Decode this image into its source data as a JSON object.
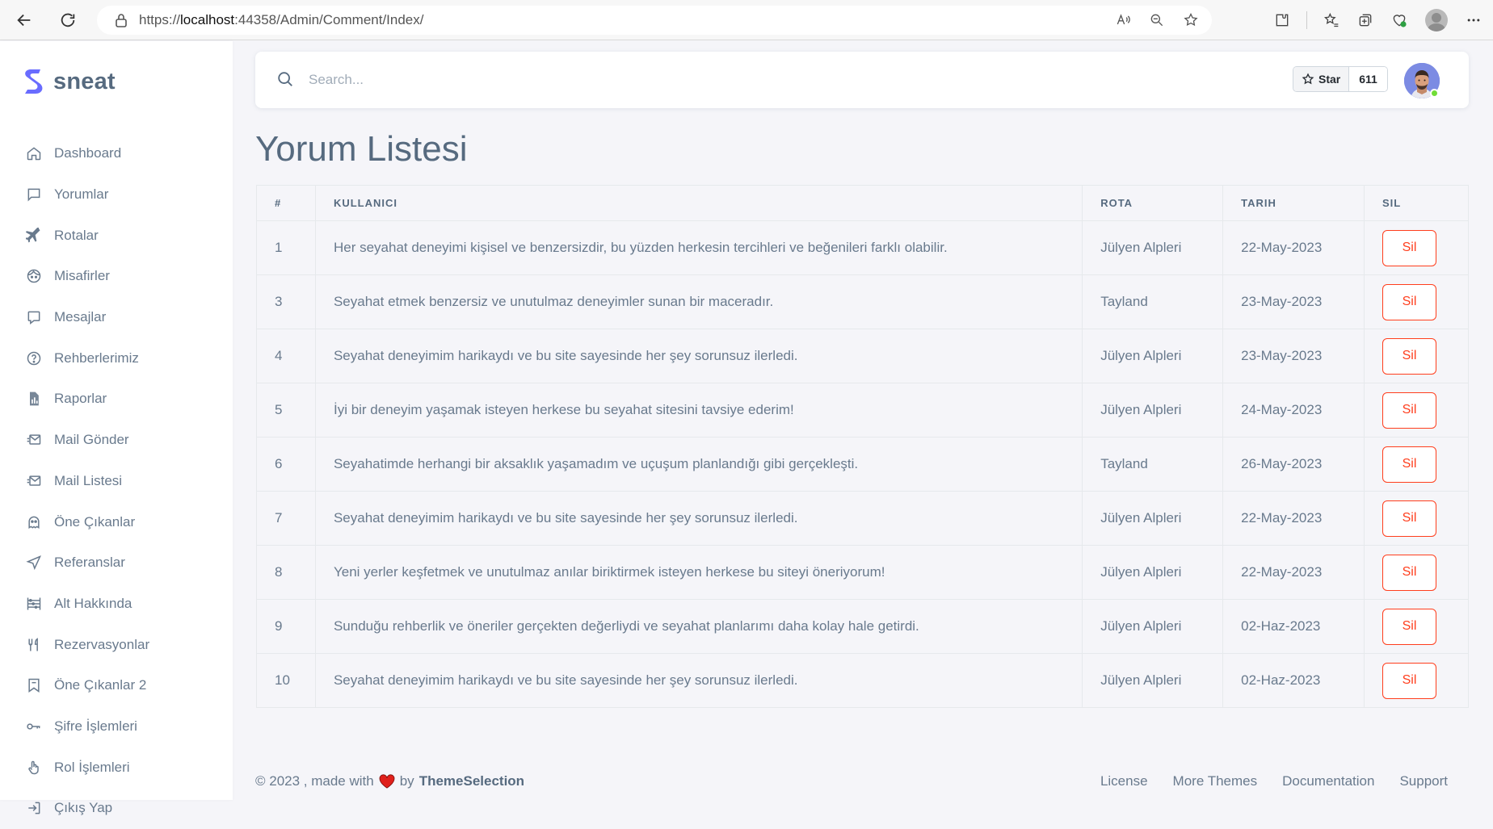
{
  "browser": {
    "url_prefix": "https://",
    "url_host": "localhost",
    "url_rest": ":44358/Admin/Comment/Index/"
  },
  "brand": {
    "name": "sneat"
  },
  "sidebar": {
    "items": [
      {
        "label": "Dashboard",
        "icon": "home-icon"
      },
      {
        "label": "Yorumlar",
        "icon": "comment-icon"
      },
      {
        "label": "Rotalar",
        "icon": "plane-icon"
      },
      {
        "label": "Misafirler",
        "icon": "face-icon"
      },
      {
        "label": "Mesajlar",
        "icon": "message-icon"
      },
      {
        "label": "Rehberlerimiz",
        "icon": "help-circle-icon"
      },
      {
        "label": "Raporlar",
        "icon": "report-file-icon"
      },
      {
        "label": "Mail Gönder",
        "icon": "mail-send-icon"
      },
      {
        "label": "Mail Listesi",
        "icon": "mail-list-icon"
      },
      {
        "label": "Öne Çıkanlar",
        "icon": "ghost-icon"
      },
      {
        "label": "Referanslar",
        "icon": "navigation-icon"
      },
      {
        "label": "Alt Hakkında",
        "icon": "abacus-icon"
      },
      {
        "label": "Rezervasyonlar",
        "icon": "restaurant-icon"
      },
      {
        "label": "Öne Çıkanlar 2",
        "icon": "map-icon"
      },
      {
        "label": "Şifre İşlemleri",
        "icon": "key-icon"
      },
      {
        "label": "Rol İşlemleri",
        "icon": "hand-icon"
      },
      {
        "label": "Çıkış Yap",
        "icon": "logout-icon"
      }
    ]
  },
  "topnav": {
    "search_placeholder": "Search...",
    "star_label": "Star",
    "star_count": "611"
  },
  "page": {
    "title": "Yorum Listesi"
  },
  "table": {
    "headers": [
      "#",
      "KULLANICI",
      "ROTA",
      "TARIH",
      "SIL"
    ],
    "rows": [
      {
        "id": "1",
        "comment": "Her seyahat deneyimi kişisel ve benzersizdir, bu yüzden herkesin tercihleri ve beğenileri farklı olabilir.",
        "route": "Jülyen Alpleri",
        "date": "22-May-2023",
        "action": "Sil"
      },
      {
        "id": "3",
        "comment": "Seyahat etmek benzersiz ve unutulmaz deneyimler sunan bir maceradır.",
        "route": "Tayland",
        "date": "23-May-2023",
        "action": "Sil"
      },
      {
        "id": "4",
        "comment": "Seyahat deneyimim harikaydı ve bu site sayesinde her şey sorunsuz ilerledi.",
        "route": "Jülyen Alpleri",
        "date": "23-May-2023",
        "action": "Sil"
      },
      {
        "id": "5",
        "comment": "İyi bir deneyim yaşamak isteyen herkese bu seyahat sitesini tavsiye ederim!",
        "route": "Jülyen Alpleri",
        "date": "24-May-2023",
        "action": "Sil"
      },
      {
        "id": "6",
        "comment": "Seyahatimde herhangi bir aksaklık yaşamadım ve uçuşum planlandığı gibi gerçekleşti.",
        "route": "Tayland",
        "date": "26-May-2023",
        "action": "Sil"
      },
      {
        "id": "7",
        "comment": "Seyahat deneyimim harikaydı ve bu site sayesinde her şey sorunsuz ilerledi.",
        "route": "Jülyen Alpleri",
        "date": "22-May-2023",
        "action": "Sil"
      },
      {
        "id": "8",
        "comment": "Yeni yerler keşfetmek ve unutulmaz anılar biriktirmek isteyen herkese bu siteyi öneriyorum!",
        "route": "Jülyen Alpleri",
        "date": "22-May-2023",
        "action": "Sil"
      },
      {
        "id": "9",
        "comment": "Sunduğu rehberlik ve öneriler gerçekten değerliydi ve seyahat planlarımı daha kolay hale getirdi.",
        "route": "Jülyen Alpleri",
        "date": "02-Haz-2023",
        "action": "Sil"
      },
      {
        "id": "10",
        "comment": "Seyahat deneyimim harikaydı ve bu site sayesinde her şey sorunsuz ilerledi.",
        "route": "Jülyen Alpleri",
        "date": "02-Haz-2023",
        "action": "Sil"
      }
    ]
  },
  "footer": {
    "prefix": "© 2023 , made with",
    "by": "by",
    "brand": "ThemeSelection",
    "links": [
      "License",
      "More Themes",
      "Documentation",
      "Support"
    ]
  },
  "colors": {
    "primary": "#696cff",
    "danger": "#ff3e1d",
    "text": "#697a8d",
    "heading": "#566a7f",
    "background": "#f5f5f9"
  }
}
